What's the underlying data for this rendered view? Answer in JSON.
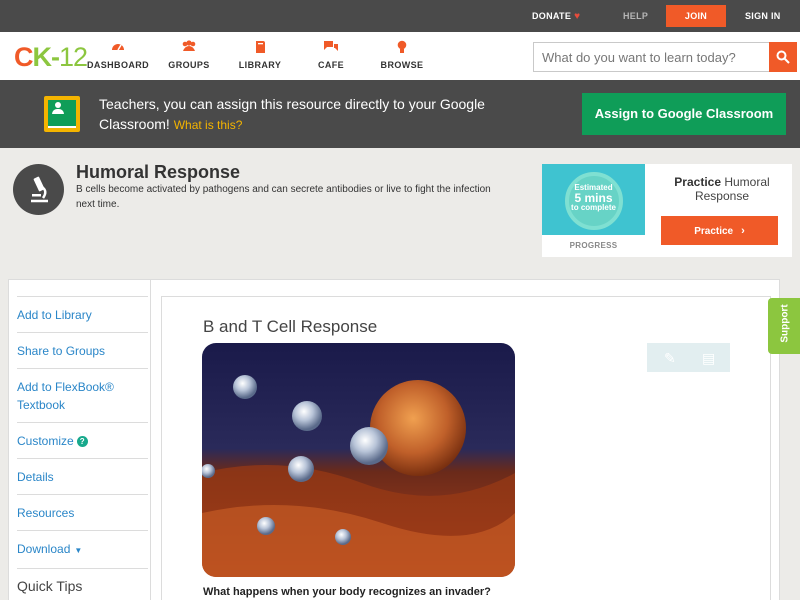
{
  "topbar": {
    "donate": "DONATE",
    "help": "HELP",
    "join": "JOIN",
    "signin": "SIGN IN"
  },
  "nav": {
    "logo_c": "C",
    "logo_k": "K",
    "logo_dash": "-",
    "logo_n": "12",
    "dashboard": "DASHBOARD",
    "groups": "GROUPS",
    "library": "LIBRARY",
    "cafe": "CAFE",
    "browse": "BROWSE",
    "search_placeholder": "What do you want to learn today?"
  },
  "banner": {
    "text": "Teachers, you can assign this resource directly to your Google Classroom!",
    "link": "What is this?",
    "button": "Assign to Google Classroom"
  },
  "concept": {
    "title": "Humoral Response",
    "description": "B cells become activated by pathogens and can secrete antibodies or live to fight the infection next time."
  },
  "practice": {
    "estimated": "Estimated",
    "mins": "5 mins",
    "to_complete": "to complete",
    "progress": "PROGRESS",
    "title_bold": "Practice",
    "title_rest": "Humoral Response",
    "button": "Practice"
  },
  "sidebar": {
    "items": [
      "Add to Library",
      "Share to Groups",
      "Add to FlexBook® Textbook",
      "Customize",
      "Details",
      "Resources",
      "Download"
    ],
    "quick_tips": "Quick Tips"
  },
  "lesson": {
    "title": "B and T Cell Response",
    "question": "What happens when your body recognizes an invader?"
  },
  "support": "Support",
  "colors": {
    "brand_orange": "#f05a28",
    "brand_green": "#8cc63f",
    "classroom_green": "#0f9d58",
    "link_blue": "#2a86c8",
    "dark_bar": "#4a4a4a"
  }
}
